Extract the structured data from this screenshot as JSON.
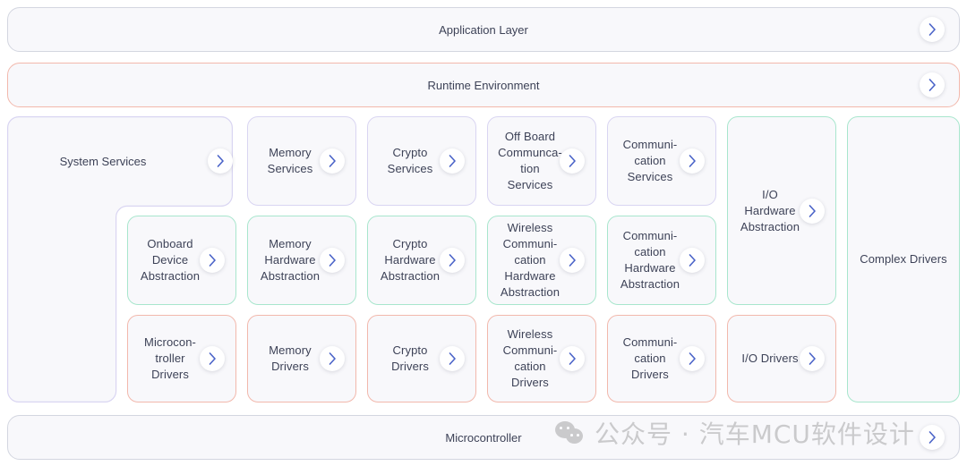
{
  "theme": {
    "page_bg": "#ffffff",
    "card_bg": "#f8f8fb",
    "text": "#3d4257",
    "chevron": "#4a63c8",
    "border_grey": "#d3d6e0",
    "border_purple": "#d9d5f2",
    "border_green": "#a8e6cd",
    "border_coral": "#f2b8ac"
  },
  "top_bars": [
    {
      "label": "Application Layer",
      "border": "grey",
      "chevron": "chevron-right-icon"
    },
    {
      "label": "Runtime Environment",
      "border": "coral",
      "chevron": "chevron-right-icon"
    }
  ],
  "bottom_bar": {
    "label": "Microcontroller",
    "border": "grey",
    "chevron": "chevron-right-icon"
  },
  "services_row": [
    {
      "label": "System Services",
      "border": "purple",
      "chevron": "chevron-right-icon"
    },
    {
      "label": "Memory\nServices",
      "border": "purple",
      "chevron": "chevron-right-icon"
    },
    {
      "label": "Crypto\nServices",
      "border": "purple",
      "chevron": "chevron-right-icon"
    },
    {
      "label": "Off Board\nCommunca-\ntion\nServices",
      "border": "purple",
      "chevron": "chevron-right-icon"
    },
    {
      "label": "Communi-\ncation\nServices",
      "border": "purple",
      "chevron": "chevron-right-icon"
    }
  ],
  "abstraction_row": [
    {
      "label": "Onboard\nDevice\nAbstraction",
      "border": "green",
      "chevron": "chevron-right-icon"
    },
    {
      "label": "Memory\nHardware\nAbstraction",
      "border": "green",
      "chevron": "chevron-right-icon"
    },
    {
      "label": "Crypto\nHardware\nAbstraction",
      "border": "green",
      "chevron": "chevron-right-icon"
    },
    {
      "label": "Wireless\nCommuni-\ncation\nHardware\nAbstraction",
      "border": "green",
      "chevron": "chevron-right-icon"
    },
    {
      "label": "Communi-\ncation\nHardware\nAbstraction",
      "border": "green",
      "chevron": "chevron-right-icon"
    }
  ],
  "drivers_row": [
    {
      "label": "Microcon-\ntroller\nDrivers",
      "border": "coral",
      "chevron": "chevron-right-icon"
    },
    {
      "label": "Memory\nDrivers",
      "border": "coral",
      "chevron": "chevron-right-icon"
    },
    {
      "label": "Crypto\nDrivers",
      "border": "coral",
      "chevron": "chevron-right-icon"
    },
    {
      "label": "Wireless\nCommuni-\ncation\nDrivers",
      "border": "coral",
      "chevron": "chevron-right-icon"
    },
    {
      "label": "Communi-\ncation\nDrivers",
      "border": "coral",
      "chevron": "chevron-right-icon"
    }
  ],
  "io_column": [
    {
      "label": "I/O\nHardware\nAbstraction",
      "border": "green",
      "chevron": "chevron-right-icon"
    },
    {
      "label": "I/O Drivers",
      "border": "coral",
      "chevron": "chevron-right-icon"
    }
  ],
  "complex_drivers": {
    "label": "Complex Drivers",
    "border": "green"
  },
  "watermark": {
    "text": "公众号 · 汽车MCU软件设计",
    "icon": "wechat-logo-icon"
  }
}
